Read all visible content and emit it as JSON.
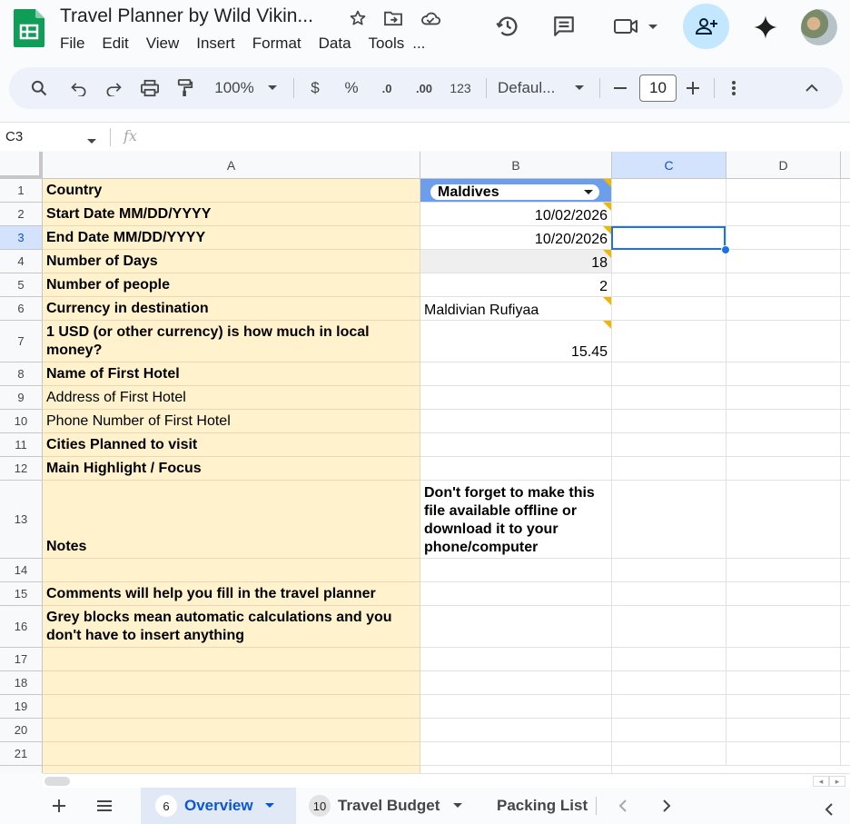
{
  "header": {
    "title": "Travel Planner by Wild Vikin...",
    "menu": [
      "File",
      "Edit",
      "View",
      "Insert",
      "Format",
      "Data",
      "Tools",
      "..."
    ]
  },
  "toolbar": {
    "zoom": "100%",
    "currency": "$",
    "percent": "%",
    "dec_decrease": ".0",
    "dec_increase": ".00",
    "number_format": "123",
    "font": "Defaul...",
    "font_size": "10"
  },
  "formula_bar": {
    "name_box": "C3",
    "fx": "fx",
    "value": ""
  },
  "grid": {
    "columns": [
      "A",
      "B",
      "C",
      "D"
    ],
    "selected_column": "C",
    "selected_row": "3",
    "rows": [
      {
        "n": "1",
        "a": "Country",
        "b": "Maldives"
      },
      {
        "n": "2",
        "a": "Start Date MM/DD/YYYY",
        "b": "10/02/2026"
      },
      {
        "n": "3",
        "a": "End Date MM/DD/YYYY",
        "b": "10/20/2026"
      },
      {
        "n": "4",
        "a": "Number of Days",
        "b": "18"
      },
      {
        "n": "5",
        "a": "Number of people",
        "b": "2"
      },
      {
        "n": "6",
        "a": "Currency in destination",
        "b": "Maldivian Rufiyaa"
      },
      {
        "n": "7",
        "a": "1 USD (or other currency) is how much in local money?",
        "b": "15.45"
      },
      {
        "n": "8",
        "a": "Name of First Hotel",
        "b": ""
      },
      {
        "n": "9",
        "a": "Address of First Hotel",
        "b": ""
      },
      {
        "n": "10",
        "a": "Phone Number of First Hotel",
        "b": ""
      },
      {
        "n": "11",
        "a": "Cities Planned to visit",
        "b": ""
      },
      {
        "n": "12",
        "a": "Main Highlight / Focus",
        "b": ""
      },
      {
        "n": "13",
        "a": "Notes",
        "b": "Don't forget to make this file available offline or download it to your phone/computer"
      },
      {
        "n": "14",
        "a": "",
        "b": ""
      },
      {
        "n": "15",
        "a": "Comments will help you fill in the travel planner",
        "b": ""
      },
      {
        "n": "16",
        "a": "Grey blocks mean automatic calculations and you don't have to insert anything",
        "b": ""
      },
      {
        "n": "17",
        "a": "",
        "b": ""
      },
      {
        "n": "18",
        "a": "",
        "b": ""
      },
      {
        "n": "19",
        "a": "",
        "b": ""
      },
      {
        "n": "20",
        "a": "",
        "b": ""
      },
      {
        "n": "21",
        "a": "",
        "b": ""
      }
    ]
  },
  "sheets": [
    {
      "badge": "6",
      "name": "Overview",
      "active": true
    },
    {
      "badge": "10",
      "name": "Travel Budget",
      "active": false
    },
    {
      "badge": "",
      "name": "Packing List",
      "active": false
    }
  ],
  "colors": {
    "accent": "#0b57d0",
    "column_a_fill": "#fff2cc",
    "calc_fill": "#efefef",
    "dropdown_fill": "#6d9eeb",
    "comment_marker": "#f2b600"
  }
}
